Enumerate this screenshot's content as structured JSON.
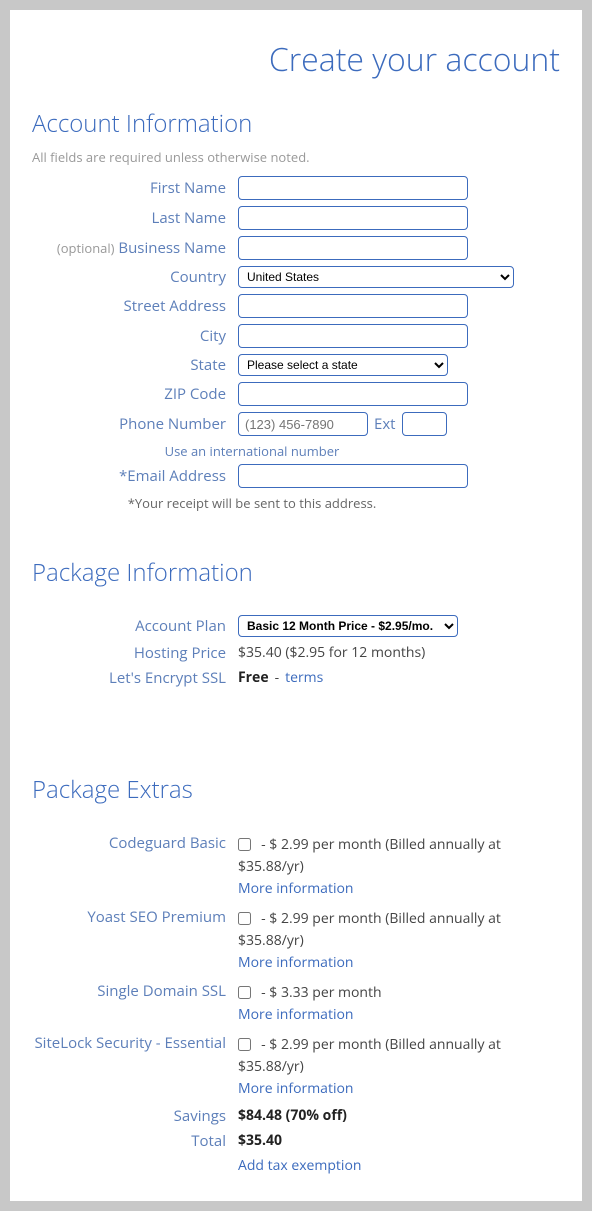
{
  "title": "Create your account",
  "account": {
    "heading": "Account Information",
    "note": "All fields are required unless otherwise noted.",
    "labels": {
      "first_name": "First Name",
      "last_name": "Last Name",
      "optional": "(optional)",
      "business_name": "Business Name",
      "country": "Country",
      "street": "Street Address",
      "city": "City",
      "state": "State",
      "zip": "ZIP Code",
      "phone": "Phone Number",
      "ext": "Ext",
      "intl_link": "Use an international number",
      "email": "*Email Address",
      "receipt_note": "*Your receipt will be sent to this address."
    },
    "values": {
      "country_selected": "United States",
      "state_placeholder": "Please select a state",
      "phone_placeholder": "(123) 456-7890"
    }
  },
  "package": {
    "heading": "Package Information",
    "labels": {
      "plan": "Account Plan",
      "hosting": "Hosting Price",
      "ssl": "Let's Encrypt SSL"
    },
    "values": {
      "plan_selected": "Basic 12 Month Price - $2.95/mo.",
      "hosting_price": "$35.40  ($2.95 for 12 months)",
      "ssl_free": "Free",
      "ssl_sep": " - ",
      "ssl_terms": "terms"
    }
  },
  "extras": {
    "heading": "Package Extras",
    "more_info": "More information",
    "items": [
      {
        "label": "Codeguard Basic",
        "price": "- $ 2.99 per month (Billed annually at $35.88/yr)"
      },
      {
        "label": "Yoast SEO Premium",
        "price": "- $ 2.99 per month (Billed annually at $35.88/yr)"
      },
      {
        "label": "Single Domain SSL",
        "price": "- $ 3.33 per month"
      },
      {
        "label": "SiteLock Security - Essential",
        "price": "- $ 2.99 per month (Billed annually at $35.88/yr)"
      }
    ],
    "savings_label": "Savings",
    "savings_value": "$84.48 (70% off)",
    "total_label": "Total",
    "total_value": "$35.40",
    "tax_link": "Add tax exemption"
  }
}
